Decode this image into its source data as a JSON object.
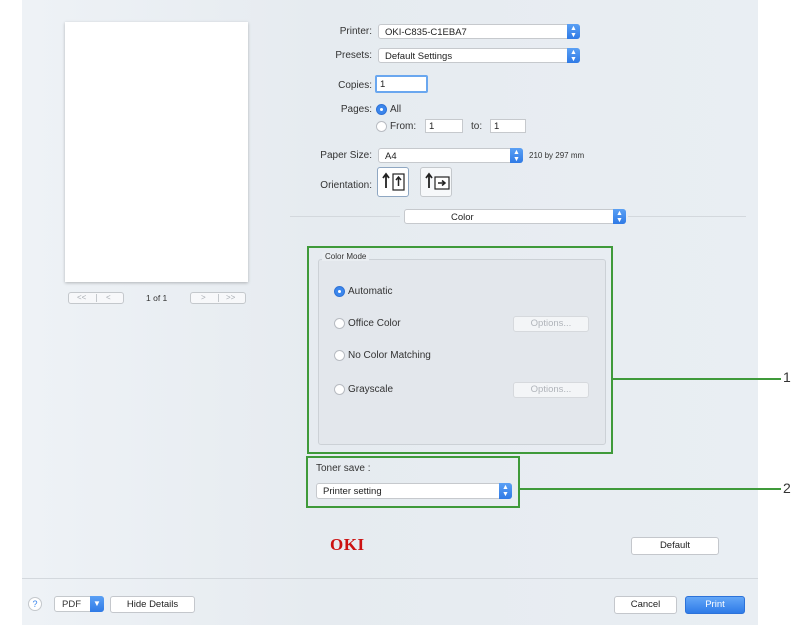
{
  "preview": {
    "page_indicator": "1 of 1",
    "first_label": "<<",
    "prev_label": "<",
    "next_label": ">",
    "last_label": ">>"
  },
  "printer": {
    "label": "Printer:",
    "value": "OKI-C835-C1EBA7"
  },
  "presets": {
    "label": "Presets:",
    "value": "Default Settings"
  },
  "copies": {
    "label": "Copies:",
    "value": "1"
  },
  "pages": {
    "label": "Pages:",
    "all": "All",
    "from": "From:",
    "from_value": "1",
    "to": "to:",
    "to_value": "1"
  },
  "paper_size": {
    "label": "Paper Size:",
    "value": "A4",
    "dimensions": "210 by 297 mm"
  },
  "orientation": {
    "label": "Orientation:"
  },
  "section": {
    "value": "Color"
  },
  "color_mode": {
    "title": "Color Mode",
    "options": [
      {
        "label": "Automatic",
        "selected": true
      },
      {
        "label": "Office Color",
        "selected": false
      },
      {
        "label": "No Color Matching",
        "selected": false
      },
      {
        "label": "Grayscale",
        "selected": false
      }
    ],
    "options_button": "Options..."
  },
  "toner_save": {
    "label": "Toner save :",
    "value": "Printer setting"
  },
  "brand": {
    "logo_text": "OKI",
    "color": "#cc1111"
  },
  "buttons": {
    "default": "Default",
    "help": "?",
    "pdf": "PDF",
    "hide_details": "Hide Details",
    "cancel": "Cancel",
    "print": "Print"
  },
  "callouts": {
    "one": "1",
    "two": "2"
  },
  "colors": {
    "accent": "#3b86ec",
    "highlight_green": "#3f9a3a"
  }
}
